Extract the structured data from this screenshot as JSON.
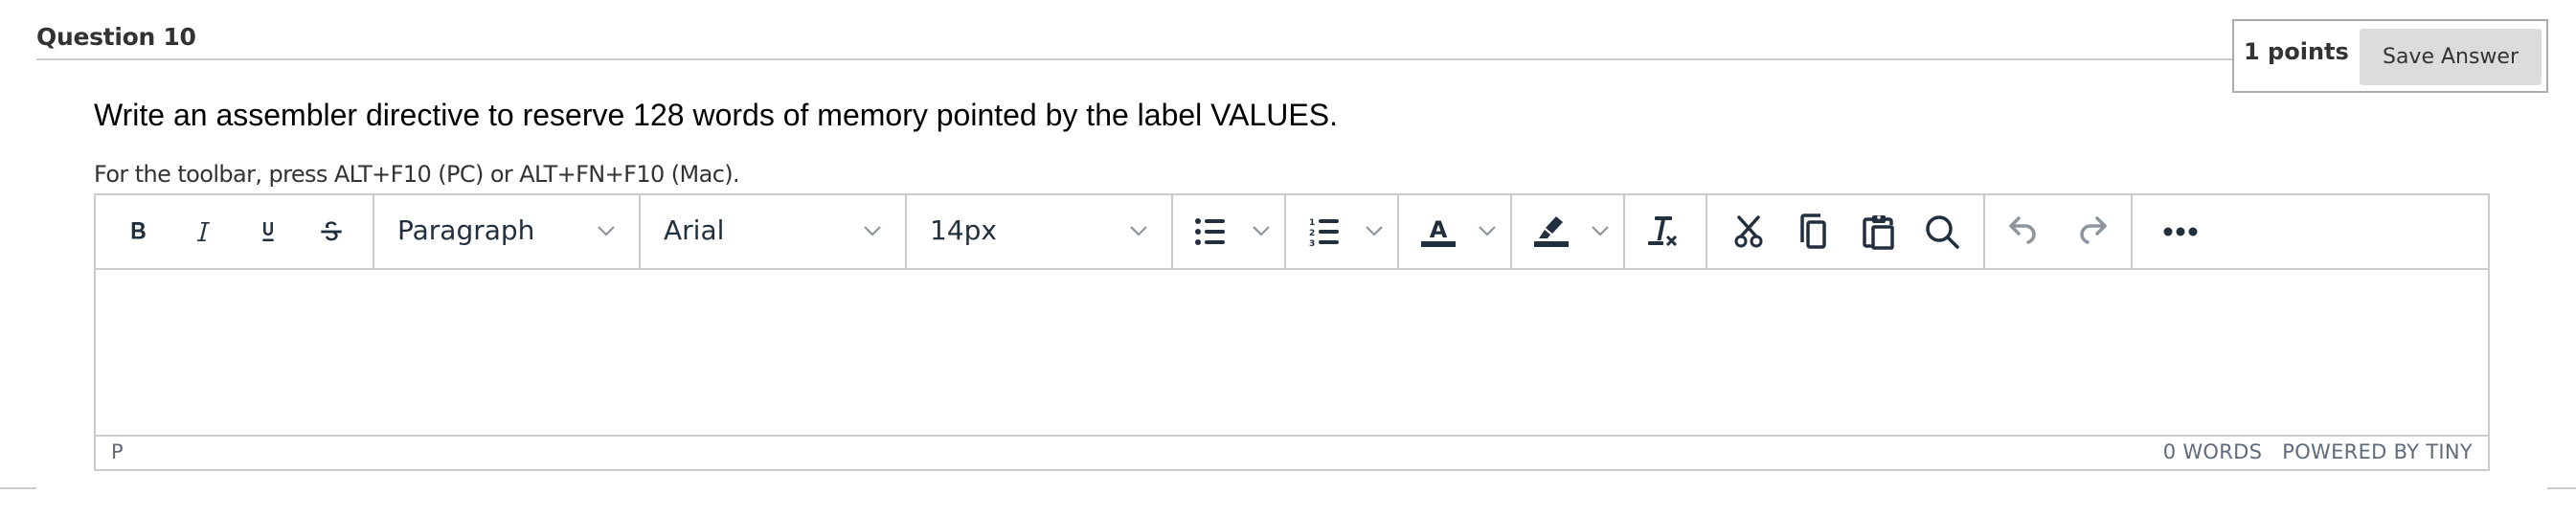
{
  "question": {
    "title": "Question 10",
    "points": "1 points",
    "save_label": "Save Answer",
    "text": "Write an assembler directive to reserve 128 words of memory pointed by the label VALUES.",
    "hint": "For the toolbar, press ALT+F10 (PC) or ALT+FN+F10 (Mac)."
  },
  "editor": {
    "toolbar": {
      "format_buttons": [
        {
          "name": "bold",
          "icon": "bold-icon"
        },
        {
          "name": "italic",
          "icon": "italic-icon"
        },
        {
          "name": "underline",
          "icon": "underline-icon"
        },
        {
          "name": "strikethrough",
          "icon": "strikethrough-icon"
        }
      ],
      "block_format": "Paragraph",
      "font_family": "Arial",
      "font_size": "14px",
      "list_buttons": [
        "bullet-list-icon",
        "numbered-list-icon"
      ],
      "color_buttons": [
        "text-color-icon",
        "highlight-color-icon"
      ],
      "clear_format": "clear-formatting-icon",
      "edit_buttons": [
        "cut-icon",
        "copy-icon",
        "paste-icon",
        "find-icon"
      ],
      "history_buttons": [
        "undo-icon",
        "redo-icon"
      ],
      "more": "more-icon"
    },
    "content": "",
    "statusbar": {
      "path": "P",
      "word_count": "0 WORDS",
      "branding": "POWERED BY TINY"
    }
  },
  "colors": {
    "icon": "#222f3e",
    "disabled_icon": "#8e959d",
    "border": "#cccccc",
    "save_button_bg": "#dcdcdc"
  }
}
